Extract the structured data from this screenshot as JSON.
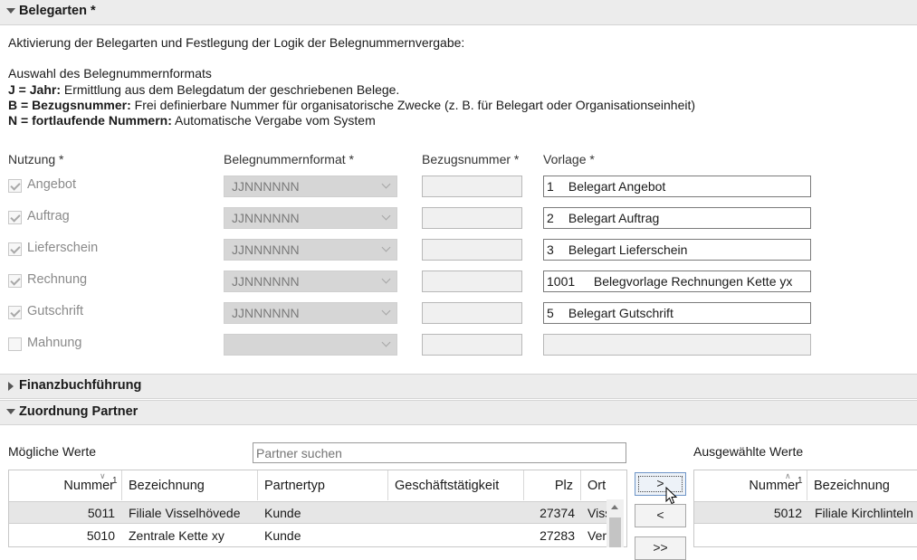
{
  "sections": {
    "belegarten": "Belegarten *",
    "finanz": "Finanzbuchführung",
    "zuordnung": "Zuordnung Partner"
  },
  "intro": "Aktivierung der Belegarten und Festlegung der Logik der Belegnummernvergabe:",
  "format_heading": "Auswahl des Belegnummernformats",
  "legend": [
    {
      "key": "J = Jahr:",
      "text": " Ermittlung aus dem Belegdatum der geschriebenen Belege."
    },
    {
      "key": "B = Bezugsnummer:",
      "text": " Frei definierbare Nummer für organisatorische Zwecke (z. B. für Belegart oder Organisationseinheit)"
    },
    {
      "key": "N = fortlaufende Nummern:",
      "text": " Automatische Vergabe vom System"
    }
  ],
  "columns": {
    "nutzung": "Nutzung *",
    "format": "Belegnummernformat *",
    "bezug": "Bezugsnummer *",
    "vorlage": "Vorlage *"
  },
  "doc_types": [
    {
      "label": "Angebot",
      "checked": true,
      "format": "JJNNNNNN",
      "vorlage_num": "1",
      "vorlage_text": "Belegart Angebot"
    },
    {
      "label": "Auftrag",
      "checked": true,
      "format": "JJNNNNNN",
      "vorlage_num": "2",
      "vorlage_text": "Belegart Auftrag"
    },
    {
      "label": "Lieferschein",
      "checked": true,
      "format": "JJNNNNNN",
      "vorlage_num": "3",
      "vorlage_text": "Belegart Lieferschein"
    },
    {
      "label": "Rechnung",
      "checked": true,
      "format": "JJNNNNNN",
      "vorlage_num": "1001",
      "vorlage_text": "Belegvorlage Rechnungen Kette yx"
    },
    {
      "label": "Gutschrift",
      "checked": true,
      "format": "JJNNNNNN",
      "vorlage_num": "5",
      "vorlage_text": "Belegart Gutschrift"
    },
    {
      "label": "Mahnung",
      "checked": false,
      "format": "",
      "vorlage_num": "",
      "vorlage_text": ""
    }
  ],
  "partner": {
    "possible_label": "Mögliche Werte",
    "selected_label": "Ausgewählte Werte",
    "search_placeholder": "Partner suchen",
    "left_headers": [
      "Nummer",
      "Bezeichnung",
      "Partnertyp",
      "Geschäftstätigkeit",
      "Plz",
      "Ort"
    ],
    "sort_index": "1",
    "left_rows": [
      {
        "nummer": "5011",
        "bezeichnung": "Filiale Visselhövede",
        "partnertyp": "Kunde",
        "geschaeft": "",
        "plz": "27374",
        "ort": "Visselhövede"
      },
      {
        "nummer": "5010",
        "bezeichnung": "Zentrale Kette xy",
        "partnertyp": "Kunde",
        "geschaeft": "",
        "plz": "27283",
        "ort": "Verden"
      }
    ],
    "right_headers": [
      "Nummer",
      "Bezeichnung"
    ],
    "right_rows": [
      {
        "nummer": "5012",
        "bezeichnung": "Filiale Kirchlinteln"
      }
    ],
    "buttons": {
      "add": ">",
      "remove": "<",
      "add_all": ">>"
    }
  }
}
